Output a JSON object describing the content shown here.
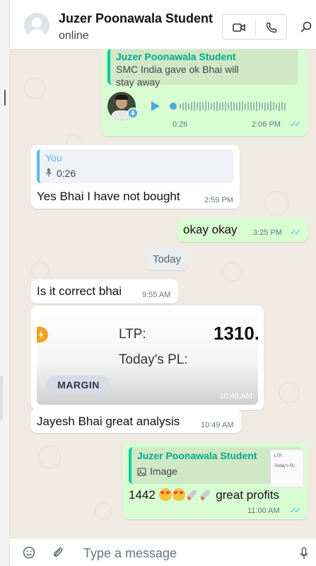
{
  "header": {
    "contact_name": "Juzer Poonawala Student",
    "status": "online",
    "video_call_icon": "video-camera-icon",
    "voice_call_icon": "phone-icon",
    "search_icon": "search-icon"
  },
  "messages": {
    "voice_msg": {
      "quote_author": "Juzer Poonawala Student",
      "quote_line1": "SMC India gave ok Bhai will",
      "quote_line2": "stay away",
      "duration": "0:26",
      "time": "2:06 PM",
      "status": "read"
    },
    "reply_in": {
      "quote_author": "You",
      "quote_voice_duration": "0:26",
      "text": "Yes Bhai I have not bought",
      "time": "2:59 PM"
    },
    "okay": {
      "text": "okay okay",
      "time": "3:25 PM",
      "status": "read"
    },
    "date_separator": "Today",
    "correct": {
      "text": "Is it correct bhai",
      "time": "9:55 AM"
    },
    "image_msg": {
      "ltp_label": "LTP:",
      "ltp_value": "1310.",
      "pl_label": "Today's PL:",
      "tag": "MARGIN",
      "time": "10:49 AM"
    },
    "analysis": {
      "text": "Jayesh Bhai great analysis",
      "time": "10:49 AM"
    },
    "profits": {
      "quote_author": "Juzer Poonawala Student",
      "quote_type": "Image",
      "thumb_ltp": "LTP:",
      "thumb_pl": "Today's PL:",
      "number": "1442",
      "text": "great profits",
      "time": "11:00 AM",
      "status": "read"
    }
  },
  "compose": {
    "placeholder": "Type a message"
  },
  "colors": {
    "outgoing_bubble": "#d9fdd3",
    "incoming_bubble": "#ffffff",
    "chat_background": "#efeae2",
    "read_ticks": "#53bdeb",
    "quote_accent": "#06cf9c"
  }
}
